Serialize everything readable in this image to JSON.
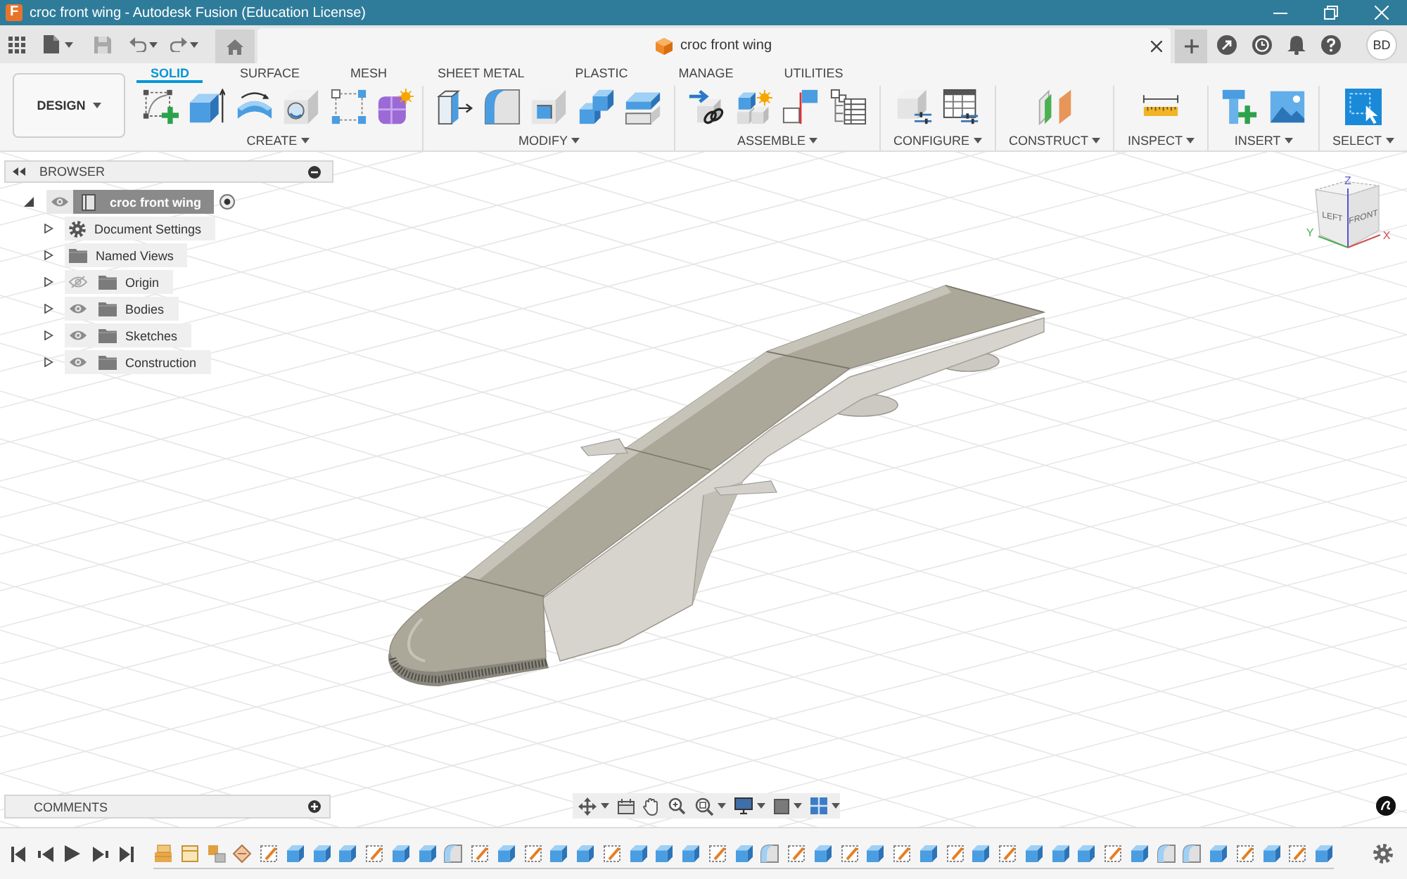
{
  "window": {
    "logo": "F",
    "title": "croc front wing - Autodesk Fusion (Education License)"
  },
  "document_tab": {
    "title": "croc front wing"
  },
  "user": {
    "initials": "BD"
  },
  "toolbar": {
    "workspace": "DESIGN",
    "tabs": [
      {
        "label": "SOLID",
        "selected": true
      },
      {
        "label": "SURFACE",
        "selected": false
      },
      {
        "label": "MESH",
        "selected": false
      },
      {
        "label": "SHEET METAL",
        "selected": false
      },
      {
        "label": "PLASTIC",
        "selected": false
      },
      {
        "label": "MANAGE",
        "selected": false
      },
      {
        "label": "UTILITIES",
        "selected": false
      }
    ],
    "groups": [
      {
        "label": "CREATE",
        "tools": [
          {
            "kind": "sketch"
          },
          {
            "kind": "extrude"
          },
          {
            "kind": "revolve"
          },
          {
            "kind": "hole"
          },
          {
            "kind": "pattern"
          },
          {
            "kind": "form"
          }
        ]
      },
      {
        "label": "MODIFY",
        "tools": [
          {
            "kind": "press_pull"
          },
          {
            "kind": "fillet"
          },
          {
            "kind": "shell"
          },
          {
            "kind": "combine"
          },
          {
            "kind": "split"
          }
        ]
      },
      {
        "label": "ASSEMBLE",
        "tools": [
          {
            "kind": "joint"
          },
          {
            "kind": "new_component"
          },
          {
            "kind": "rigid"
          },
          {
            "kind": "tree_table"
          }
        ]
      },
      {
        "label": "CONFIGURE",
        "tools": [
          {
            "kind": "config_cube"
          },
          {
            "kind": "config_table"
          }
        ]
      },
      {
        "label": "CONSTRUCT",
        "tools": [
          {
            "kind": "planes"
          }
        ]
      },
      {
        "label": "INSPECT",
        "tools": [
          {
            "kind": "measure"
          }
        ]
      },
      {
        "label": "INSERT",
        "tools": [
          {
            "kind": "bolt"
          },
          {
            "kind": "image"
          }
        ]
      },
      {
        "label": "SELECT",
        "tools": [
          {
            "kind": "select"
          }
        ]
      }
    ]
  },
  "browser": {
    "title": "BROWSER",
    "root": {
      "label": "croc front wing",
      "expanded": true,
      "visible": true,
      "active": true,
      "children": [
        {
          "label": "Document Settings",
          "kind": "settings",
          "expanded": false
        },
        {
          "label": "Named Views",
          "kind": "folder",
          "expanded": false
        },
        {
          "label": "Origin",
          "kind": "folder",
          "expanded": false,
          "visible": false
        },
        {
          "label": "Bodies",
          "kind": "folder",
          "expanded": false,
          "visible": true
        },
        {
          "label": "Sketches",
          "kind": "folder",
          "expanded": false,
          "visible": true
        },
        {
          "label": "Construction",
          "kind": "folder",
          "expanded": false,
          "visible": true
        }
      ]
    }
  },
  "view_cube": {
    "faces": [
      "LEFT",
      "FRONT"
    ],
    "axis_labels": [
      "X",
      "Y",
      "Z"
    ]
  },
  "comments": {
    "title": "COMMENTS"
  },
  "timeline": {
    "items": [
      {
        "kind": "component"
      },
      {
        "kind": "frame"
      },
      {
        "kind": "joint"
      },
      {
        "kind": "appearance"
      },
      {
        "kind": "sketch"
      },
      {
        "kind": "extrude"
      },
      {
        "kind": "extrude"
      },
      {
        "kind": "extrude"
      },
      {
        "kind": "sketch"
      },
      {
        "kind": "extrude"
      },
      {
        "kind": "extrude"
      },
      {
        "kind": "fillet"
      },
      {
        "kind": "sketch"
      },
      {
        "kind": "extrude"
      },
      {
        "kind": "sketch"
      },
      {
        "kind": "extrude"
      },
      {
        "kind": "extrude"
      },
      {
        "kind": "sketch"
      },
      {
        "kind": "extrude"
      },
      {
        "kind": "extrude"
      },
      {
        "kind": "extrude"
      },
      {
        "kind": "sketch"
      },
      {
        "kind": "extrude"
      },
      {
        "kind": "fillet"
      },
      {
        "kind": "sketch"
      },
      {
        "kind": "extrude"
      },
      {
        "kind": "sketch"
      },
      {
        "kind": "extrude"
      },
      {
        "kind": "sketch"
      },
      {
        "kind": "extrude"
      },
      {
        "kind": "sketch"
      },
      {
        "kind": "extrude"
      },
      {
        "kind": "sketch"
      },
      {
        "kind": "extrude"
      },
      {
        "kind": "extrude"
      },
      {
        "kind": "extrude"
      },
      {
        "kind": "sketch"
      },
      {
        "kind": "extrude"
      },
      {
        "kind": "fillet"
      },
      {
        "kind": "fillet"
      },
      {
        "kind": "extrude"
      },
      {
        "kind": "sketch"
      },
      {
        "kind": "extrude"
      },
      {
        "kind": "sketch"
      },
      {
        "kind": "extrude"
      }
    ]
  }
}
